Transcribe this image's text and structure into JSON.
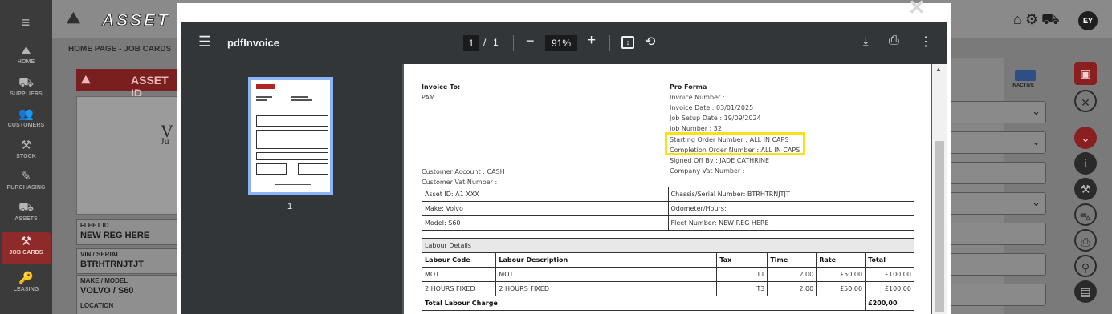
{
  "sidebar": {
    "items": [
      {
        "label": "HOME",
        "icon": "home-icon",
        "glyph": "⛰"
      },
      {
        "label": "SUPPLIERS",
        "icon": "suppliers-icon",
        "glyph": "⛟"
      },
      {
        "label": "CUSTOMERS",
        "icon": "customers-icon",
        "glyph": "👥"
      },
      {
        "label": "STOCK",
        "icon": "stock-icon",
        "glyph": "⚒"
      },
      {
        "label": "PURCHASING",
        "icon": "purchasing-icon",
        "glyph": "✎"
      },
      {
        "label": "ASSETS",
        "icon": "assets-icon",
        "glyph": "⛟"
      },
      {
        "label": "JOB CARDS",
        "icon": "job-cards-icon",
        "glyph": "⚒"
      },
      {
        "label": "LEASING",
        "icon": "leasing-icon",
        "glyph": "🔑"
      }
    ]
  },
  "app": {
    "logo_text": "ASSET",
    "breadcrumb": "HOME PAGE  -  JOB CARDS",
    "asset_banner": "ASSET ID",
    "photo_text_1": "V",
    "photo_text_2": "Ju",
    "fields": [
      {
        "label": "FLEET ID",
        "value": "NEW REG HERE"
      },
      {
        "label": "VIN / SERIAL",
        "value": "BTRHTRNJTJT"
      },
      {
        "label": "MAKE / MODEL",
        "value": "VOLVO / S60"
      },
      {
        "label": "LOCATION",
        "value": ""
      }
    ],
    "inactive_label": "INACTIVE",
    "avatar_initials": "EY"
  },
  "viewer": {
    "title": "pdfInvoice",
    "page_current": "1",
    "page_separator": "/",
    "page_total": "1",
    "zoom": "91%",
    "thumb_page_number": "1"
  },
  "invoice": {
    "invoice_to_label": "Invoice To:",
    "invoice_to_name": "PAM",
    "pro_forma_label": "Pro Forma",
    "invoice_number": "Invoice Number :",
    "invoice_date": "Invoice Date : 03/01/2025",
    "job_setup_date": "Job Setup Date : 19/09/2024",
    "job_number": "Job Number : 32",
    "starting_order": "Starting Order Number : ALL IN CAPS",
    "completion_order": "Completion Order Number : ALL IN CAPS",
    "signed_off": "Signed Off By : JADE CATHRINE",
    "company_vat": "Company Vat Number :",
    "customer_account": "Customer Account : CASH",
    "customer_vat": "Customer Vat Number :",
    "asset_rows": [
      {
        "left": "Asset ID: A1 XXX",
        "right": "Chassis/Serial Number: BTRHTRNJTJT"
      },
      {
        "left": "Make: Volvo",
        "right": "Odometer/Hours:"
      },
      {
        "left": "Model: S60",
        "right": "Fleet Number: NEW REG HERE"
      }
    ],
    "labour": {
      "section_title": "Labour Details",
      "headers": [
        "Labour Code",
        "Labour Description",
        "Tax",
        "Time",
        "Rate",
        "Total"
      ],
      "rows": [
        [
          "MOT",
          "MOT",
          "T1",
          "2.00",
          "£50,00",
          "£100,00"
        ],
        [
          "2 HOURS FIXED",
          "2 HOURS FIXED",
          "T3",
          "2.00",
          "£50,00",
          "£100,00"
        ]
      ],
      "total_label": "Total Labour Charge",
      "total_value": "£200,00"
    }
  },
  "colors": {
    "highlight": "#f5e21a",
    "viewer_bar": "#323639",
    "accent_red": "#8a1f1f"
  }
}
